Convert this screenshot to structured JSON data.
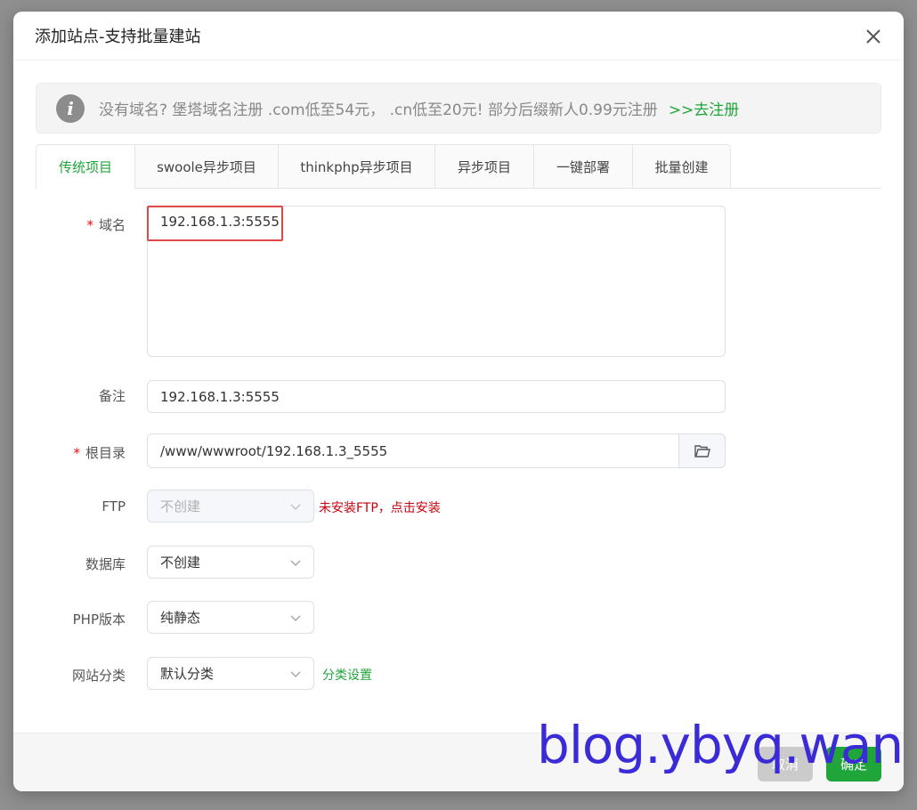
{
  "dialog": {
    "title": "添加站点-支持批量建站"
  },
  "notice": {
    "icon": "info-icon",
    "text": "没有域名? 堡塔域名注册 .com低至54元，  .cn低至20元! 部分后缀新人0.99元注册",
    "link": ">>去注册"
  },
  "tabs": [
    {
      "label": "传统项目",
      "active": true
    },
    {
      "label": "swoole异步项目",
      "active": false
    },
    {
      "label": "thinkphp异步项目",
      "active": false
    },
    {
      "label": "异步项目",
      "active": false
    },
    {
      "label": "一键部署",
      "active": false
    },
    {
      "label": "批量创建",
      "active": false
    }
  ],
  "form": {
    "required_mark": "*",
    "domain_label": "域名",
    "domain_value": "192.168.1.3:5555",
    "remark_label": "备注",
    "remark_value": "192.168.1.3:5555",
    "root_label": "根目录",
    "root_value": "/www/wwwroot/192.168.1.3_5555",
    "ftp_label": "FTP",
    "ftp_value": "不创建",
    "ftp_note": "未安装FTP，点击安装",
    "db_label": "数据库",
    "db_value": "不创建",
    "php_label": "PHP版本",
    "php_value": "纯静态",
    "category_label": "网站分类",
    "category_value": "默认分类",
    "category_link": "分类设置"
  },
  "footer": {
    "cancel_label": "取消",
    "ok_label": "确定"
  },
  "watermark": "blog.ybyq.wang",
  "colors": {
    "accent": "#20a53a",
    "required": "#ef0808",
    "warning_text": "#c7000b",
    "highlight_box": "#e04848",
    "watermark": "#3a2bd6"
  }
}
